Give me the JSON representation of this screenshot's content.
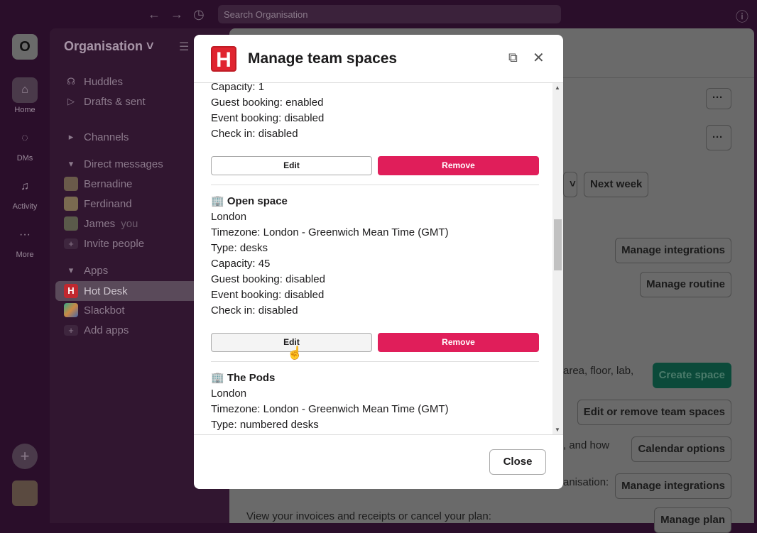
{
  "topbar": {
    "search_placeholder": "Search Organisation"
  },
  "rail": {
    "workspace_initial": "O",
    "items": [
      {
        "label": "Home",
        "icon": "home-icon"
      },
      {
        "label": "DMs",
        "icon": "dms-icon"
      },
      {
        "label": "Activity",
        "icon": "bell-icon"
      },
      {
        "label": "More",
        "icon": "more-icon"
      }
    ]
  },
  "sidebar": {
    "org_name": "Organisation",
    "top_items": [
      "Huddles",
      "Drafts & sent"
    ],
    "channels_label": "Channels",
    "dm_label": "Direct messages",
    "dms": [
      {
        "name": "Bernadine"
      },
      {
        "name": "Ferdinand"
      },
      {
        "name": "James",
        "suffix": "you"
      }
    ],
    "invite": "Invite people",
    "apps_label": "Apps",
    "apps": [
      "Hot Desk",
      "Slackbot"
    ],
    "add_apps": "Add apps"
  },
  "main": {
    "next_week": "Next week",
    "manage_integrations": "Manage integrations",
    "manage_routine": "Manage routine",
    "text_area": "area, floor, lab,",
    "create_space": "Create space",
    "edit_remove": "Edit or remove team spaces",
    "text_how": ", and how",
    "calendar_options": "Calendar options",
    "text_org": "anisation:",
    "manage_integrations_2": "Manage integrations",
    "invoices_text": "View your invoices and receipts or cancel your plan:",
    "manage_plan": "Manage plan",
    "more": "···"
  },
  "modal": {
    "title": "Manage team spaces",
    "logo": "H",
    "close_label": "Close",
    "edit_label": "Edit",
    "remove_label": "Remove",
    "partial": [
      "Capacity: 1",
      "Guest booking: enabled",
      "Event booking: disabled",
      "Check in: disabled"
    ],
    "spaces": [
      {
        "name": "Open space",
        "lines": [
          "London",
          "Timezone: London - Greenwich Mean Time (GMT)",
          "Type: desks",
          "Capacity: 45",
          "Guest booking: disabled",
          "Event booking: disabled",
          "Check in: disabled"
        ]
      },
      {
        "name": "The Pods",
        "lines": [
          "London",
          "Timezone: London - Greenwich Mean Time (GMT)",
          "Type: numbered desks"
        ]
      }
    ]
  },
  "colors": {
    "accent_remove": "#e01e5a",
    "create_space": "#0b4a3a",
    "logo_red": "#e0242f"
  }
}
